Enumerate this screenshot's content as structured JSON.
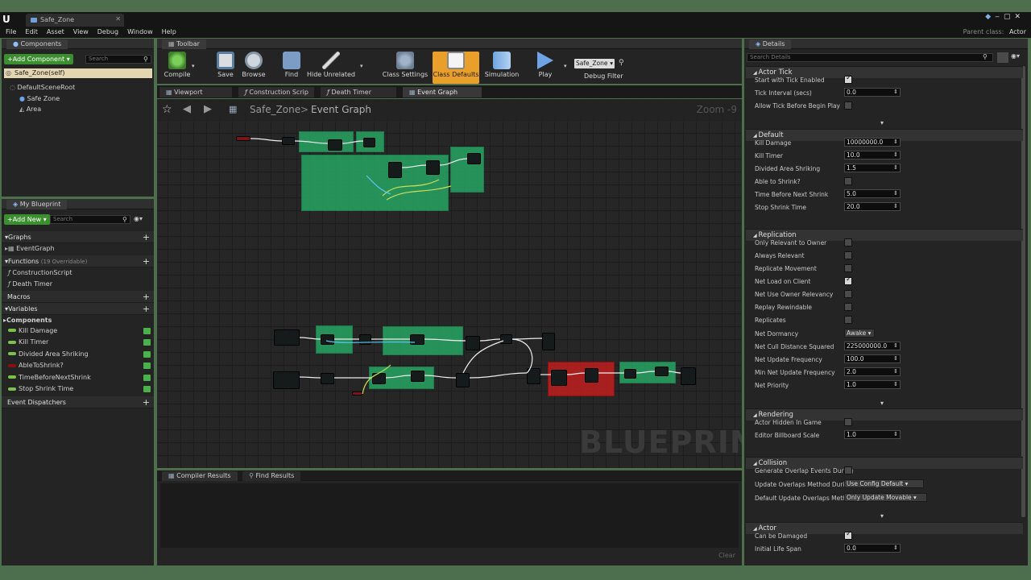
{
  "title_bar": {
    "app_logo": "U",
    "tab_title": "Safe_Zone",
    "parent_class_label": "Parent class:",
    "parent_class_value": "Actor"
  },
  "menu": [
    "File",
    "Edit",
    "Asset",
    "View",
    "Debug",
    "Window",
    "Help"
  ],
  "components_panel": {
    "title": "Components",
    "add_button": "Add Component",
    "search_placeholder": "Search",
    "self_item": "Safe_Zone(self)",
    "tree": [
      "DefaultSceneRoot",
      "Safe Zone",
      "Area"
    ]
  },
  "my_blueprint": {
    "title": "My Blueprint",
    "add_button": "Add New",
    "search_placeholder": "Search",
    "graphs_label": "Graphs",
    "graphs": [
      "EventGraph"
    ],
    "functions_label": "Functions",
    "functions_override": "(19 Overridable)",
    "functions": [
      "ConstructionScript",
      "Death Timer"
    ],
    "macros_label": "Macros",
    "variables_label": "Variables",
    "components_label": "Components",
    "variables": [
      {
        "name": "Kill Damage",
        "color": "#7cc24a"
      },
      {
        "name": "Kill Timer",
        "color": "#7cc24a"
      },
      {
        "name": "Divided Area Shriking",
        "color": "#7cc24a"
      },
      {
        "name": "AbleToShrink?",
        "color": "#8b1010"
      },
      {
        "name": "TimeBeforeNextShrink",
        "color": "#7cc24a"
      },
      {
        "name": "Stop Shrink Time",
        "color": "#7cc24a"
      }
    ],
    "dispatchers_label": "Event Dispatchers"
  },
  "toolbar": {
    "title": "Toolbar",
    "buttons": [
      "Compile",
      "Save",
      "Browse",
      "Find",
      "Hide Unrelated",
      "Class Settings",
      "Class Defaults",
      "Simulation",
      "Play"
    ],
    "debug_object": "Safe_Zone",
    "debug_filter": "Debug Filter"
  },
  "doc_tabs": [
    "Viewport",
    "Construction Scrip",
    "Death Timer",
    "Event Graph"
  ],
  "graph": {
    "breadcrumb_root": "Safe_Zone",
    "breadcrumb_sep": ">",
    "breadcrumb_page": "Event Graph",
    "zoom": "Zoom -9",
    "watermark": "BLUEPRINT"
  },
  "bottom_panel": {
    "tabs": [
      "Compiler Results",
      "Find Results"
    ],
    "clear": "Clear"
  },
  "details": {
    "title": "Details",
    "search_placeholder": "Search Details",
    "sections": {
      "actor_tick": "Actor Tick",
      "default": "Default",
      "replication": "Replication",
      "rendering": "Rendering",
      "collision": "Collision",
      "actor": "Actor"
    },
    "actor_tick": [
      {
        "label": "Start with Tick Enabled",
        "checked": true
      },
      {
        "label": "Tick Interval (secs)",
        "value": "0.0"
      },
      {
        "label": "Allow Tick Before Begin Play",
        "checked": false
      }
    ],
    "default": [
      {
        "label": "Kill Damage",
        "value": "10000000.0"
      },
      {
        "label": "Kill Timer",
        "value": "10.0"
      },
      {
        "label": "Divided Area Shriking",
        "value": "1.5"
      },
      {
        "label": "Able to Shrink?",
        "checked": false
      },
      {
        "label": "Time Before Next Shrink",
        "value": "5.0"
      },
      {
        "label": "Stop Shrink Time",
        "value": "20.0"
      }
    ],
    "replication": [
      {
        "label": "Only Relevant to Owner",
        "checked": false
      },
      {
        "label": "Always Relevant",
        "checked": false
      },
      {
        "label": "Replicate Movement",
        "checked": false
      },
      {
        "label": "Net Load on Client",
        "checked": true
      },
      {
        "label": "Net Use Owner Relevancy",
        "checked": false
      },
      {
        "label": "Replay Rewindable",
        "checked": false
      },
      {
        "label": "Replicates",
        "checked": false
      },
      {
        "label": "Net Dormancy",
        "option": "Awake"
      },
      {
        "label": "Net Cull Distance Squared",
        "value": "225000000.0"
      },
      {
        "label": "Net Update Frequency",
        "value": "100.0"
      },
      {
        "label": "Min Net Update Frequency",
        "value": "2.0"
      },
      {
        "label": "Net Priority",
        "value": "1.0"
      }
    ],
    "rendering": [
      {
        "label": "Actor Hidden In Game",
        "checked": false
      },
      {
        "label": "Editor Billboard Scale",
        "value": "1.0"
      }
    ],
    "collision": [
      {
        "label": "Generate Overlap Events During",
        "checked": false
      },
      {
        "label": "Update Overlaps Method During",
        "option": "Use Config Default"
      },
      {
        "label": "Default Update Overlaps Method",
        "option": "Only Update Movable"
      }
    ],
    "actor": [
      {
        "label": "Can be Damaged",
        "checked": true
      },
      {
        "label": "Initial Life Span",
        "value": "0.0"
      }
    ]
  }
}
